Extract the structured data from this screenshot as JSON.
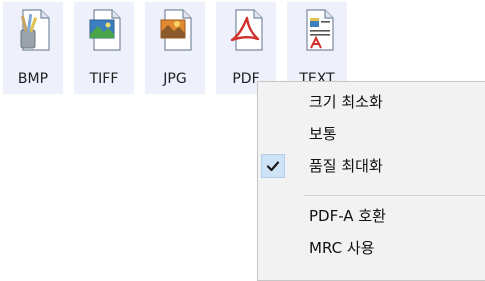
{
  "formats": [
    {
      "label": "BMP",
      "icon": "bmp-file-icon"
    },
    {
      "label": "TIFF",
      "icon": "tiff-file-icon"
    },
    {
      "label": "JPG",
      "icon": "jpg-file-icon"
    },
    {
      "label": "PDF",
      "icon": "pdf-file-icon"
    },
    {
      "label": "TEXT",
      "icon": "text-file-icon"
    }
  ],
  "menu": {
    "items": [
      {
        "label": "크기 최소화",
        "checked": false
      },
      {
        "label": "보통",
        "checked": false
      },
      {
        "label": "품질 최대화",
        "checked": true
      },
      {
        "label": "PDF-A 호환",
        "checked": false
      },
      {
        "label": "MRC 사용",
        "checked": false
      }
    ]
  },
  "colors": {
    "button_bg": "#eef0fb",
    "menu_bg": "#f2f2f2",
    "check_bg": "#cfe3f7",
    "pdf_red": "#d2322d"
  }
}
